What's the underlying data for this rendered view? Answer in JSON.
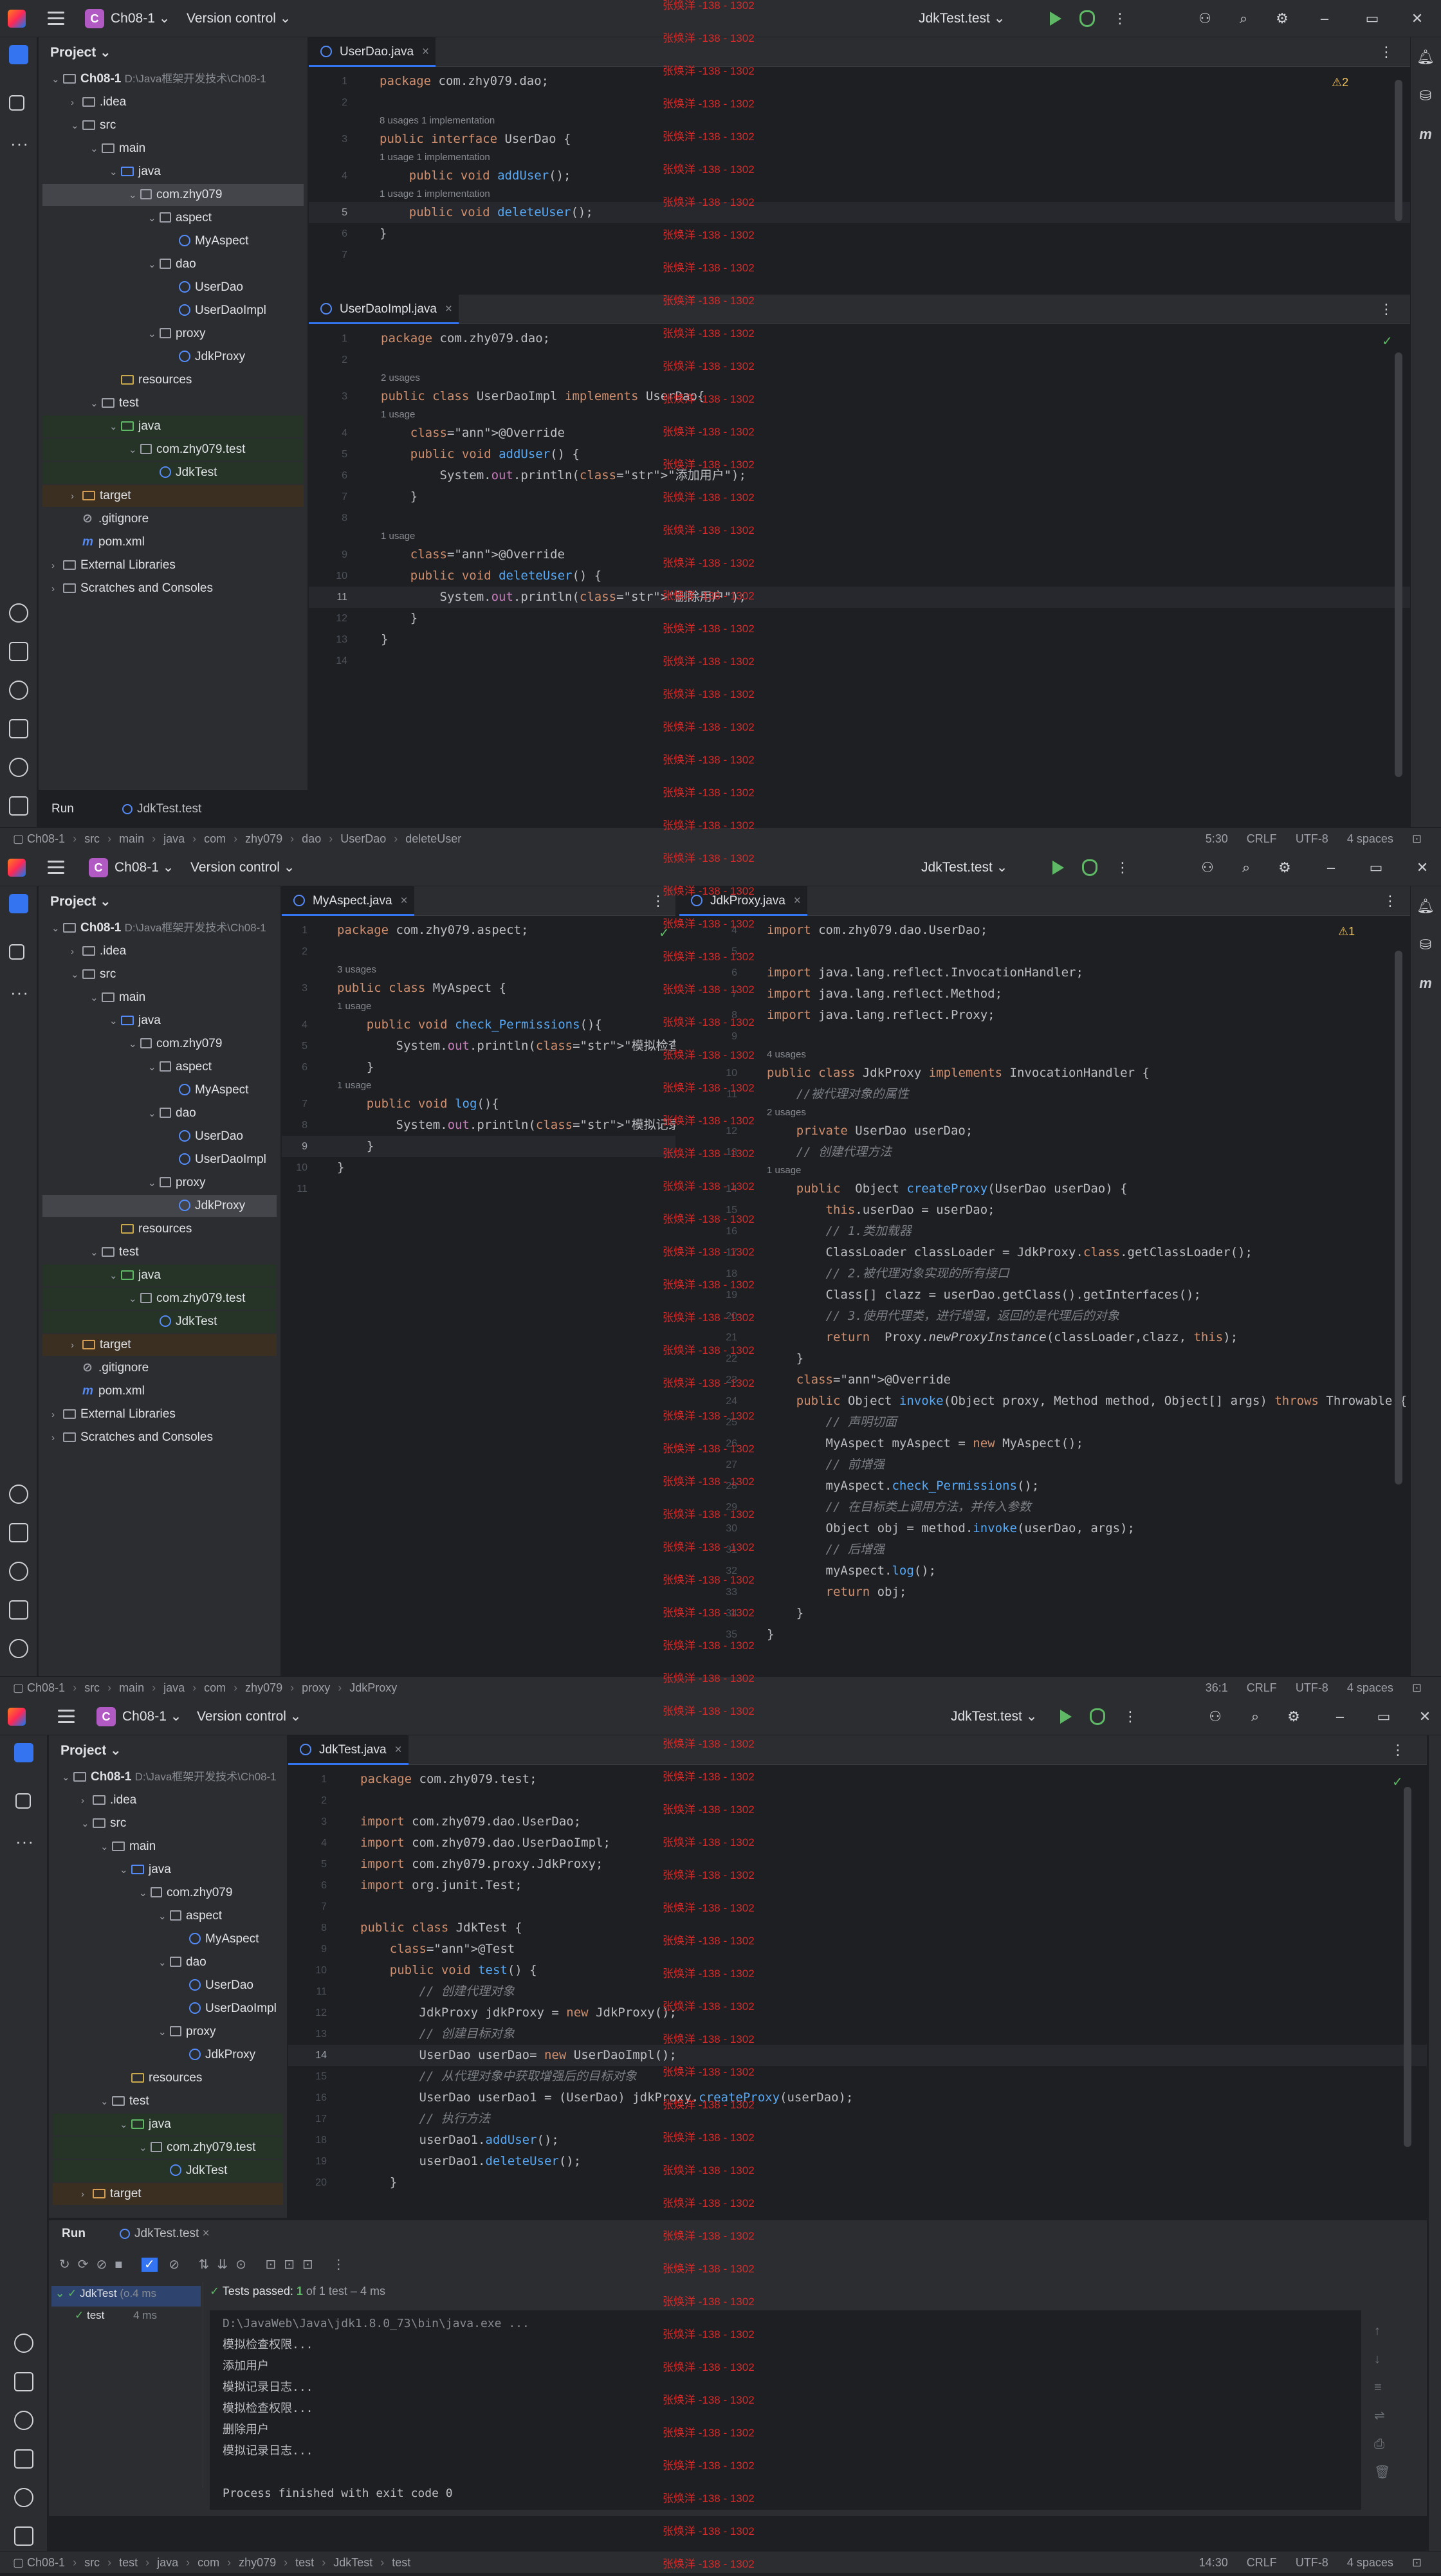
{
  "watermark": "张焕洋 -138 - 1302",
  "project": {
    "badge": "C",
    "name": "Ch08-1",
    "vcs": "Version control",
    "run_config": "JdkTest.test",
    "panel_title": "Project"
  },
  "tree": {
    "root": "Ch08-1",
    "root_path": "D:\\Java框架开发技术\\Ch08-1",
    "idea": ".idea",
    "src": "src",
    "main": "main",
    "java": "java",
    "pkg": "com.zhy079",
    "aspect": "aspect",
    "myaspect": "MyAspect",
    "dao": "dao",
    "userdao": "UserDao",
    "userdaoimpl": "UserDaoImpl",
    "proxy": "proxy",
    "jdkproxy": "JdkProxy",
    "resources": "resources",
    "test": "test",
    "test_java": "java",
    "test_pkg": "com.zhy079.test",
    "jdktest": "JdkTest",
    "target": "target",
    "gitignore": ".gitignore",
    "pom": "pom.xml",
    "ext_libs": "External Libraries",
    "scratches": "Scratches and Consoles"
  },
  "win1": {
    "tab_a": "UserDao.java",
    "tab_b": "UserDaoImpl.java",
    "warn": "⚠2",
    "usages_8": "8 usages",
    "impl_1": "1 implementation",
    "usage_1": "1 usage",
    "usages_2": "2 usages",
    "run_label": "Run",
    "run_tab": "JdkTest.test",
    "status_path": [
      "Ch08-1",
      "src",
      "main",
      "java",
      "com",
      "zhy079",
      "dao",
      "UserDao",
      "deleteUser"
    ],
    "status_pos": "5:30",
    "status_le": "CRLF",
    "status_enc": "UTF-8",
    "status_indent": "4 spaces"
  },
  "win2": {
    "tab_a": "MyAspect.java",
    "tab_b": "JdkProxy.java",
    "warn": "⚠1",
    "usages_3": "3 usages",
    "usage_1": "1 usage",
    "usages_4": "4 usages",
    "usages_2": "2 usages",
    "status_path": [
      "Ch08-1",
      "src",
      "main",
      "java",
      "com",
      "zhy079",
      "proxy",
      "JdkProxy"
    ],
    "status_pos": "36:1",
    "status_le": "CRLF",
    "status_enc": "UTF-8",
    "status_indent": "4 spaces"
  },
  "win3": {
    "tab_a": "JdkTest.java",
    "run_label": "Run",
    "run_tab": "JdkTest.test",
    "tests_passed": "Tests passed:",
    "tests_count": "1",
    "tests_of": "of 1 test – 4 ms",
    "tree_root": "JdkTest",
    "tree_root_time": "(o.4 ms",
    "tree_test": "test",
    "tree_test_time": "4 ms",
    "console": [
      "D:\\JavaWeb\\Java\\jdk1.8.0_73\\bin\\java.exe ...",
      "模拟检查权限...",
      "添加用户",
      "模拟记录日志...",
      "模拟检查权限...",
      "删除用户",
      "模拟记录日志...",
      "",
      "Process finished with exit code 0"
    ],
    "status_path": [
      "Ch08-1",
      "src",
      "test",
      "java",
      "com",
      "zhy079",
      "test",
      "JdkTest",
      "test"
    ],
    "status_pos": "14:30",
    "status_le": "CRLF",
    "status_enc": "UTF-8",
    "status_indent": "4 spaces"
  },
  "code": {
    "userdao": [
      "package com.zhy079.dao;",
      "",
      "public interface UserDao {",
      "    public void addUser();",
      "    public void deleteUser();",
      "}",
      ""
    ],
    "userdaoimpl": [
      "package com.zhy079.dao;",
      "",
      "public class UserDaoImpl implements UserDao{",
      "    @Override",
      "    public void addUser() {",
      "        System.out.println(\"添加用户\");",
      "    }",
      "",
      "    @Override",
      "    public void deleteUser() {",
      "        System.out.println(\"删除用户\");",
      "    }",
      "}",
      ""
    ],
    "myaspect": [
      "package com.zhy079.aspect;",
      "",
      "public class MyAspect {",
      "    public void check_Permissions(){",
      "        System.out.println(\"模拟检查权限...\");",
      "    }",
      "    public void log(){",
      "        System.out.println(\"模拟记录日志...\");",
      "    }",
      "}",
      ""
    ],
    "jdkproxy": [
      "import com.zhy079.dao.UserDao;",
      "",
      "import java.lang.reflect.InvocationHandler;",
      "import java.lang.reflect.Method;",
      "import java.lang.reflect.Proxy;",
      "",
      "public class JdkProxy implements InvocationHandler {",
      "    //被代理对象的属性",
      "    private UserDao userDao;",
      "    // 创建代理方法",
      "    public  Object createProxy(UserDao userDao) {",
      "        this.userDao = userDao;",
      "        // 1.类加载器",
      "        ClassLoader classLoader = JdkProxy.class.getClassLoader();",
      "        // 2.被代理对象实现的所有接口",
      "        Class[] clazz = userDao.getClass().getInterfaces();",
      "        // 3.使用代理类，进行增强，返回的是代理后的对象",
      "        return  Proxy.newProxyInstance(classLoader,clazz, this);",
      "    }",
      "    @Override",
      "    public Object invoke(Object proxy, Method method, Object[] args) throws Throwable {",
      "        // 声明切面",
      "        MyAspect myAspect = new MyAspect();",
      "        // 前增强",
      "        myAspect.check_Permissions();",
      "        // 在目标类上调用方法，并传入参数",
      "        Object obj = method.invoke(userDao, args);",
      "        // 后增强",
      "        myAspect.log();",
      "        return obj;",
      "    }",
      "}"
    ],
    "jdktest": [
      "package com.zhy079.test;",
      "",
      "import com.zhy079.dao.UserDao;",
      "import com.zhy079.dao.UserDaoImpl;",
      "import com.zhy079.proxy.JdkProxy;",
      "import org.junit.Test;",
      "",
      "public class JdkTest {",
      "    @Test",
      "    public void test() {",
      "        // 创建代理对象",
      "        JdkProxy jdkProxy = new JdkProxy();",
      "        // 创建目标对象",
      "        UserDao userDao= new UserDaoImpl();",
      "        // 从代理对象中获取增强后的目标对象",
      "        UserDao userDao1 = (UserDao) jdkProxy.createProxy(userDao);",
      "        // 执行方法",
      "        userDao1.addUser();",
      "        userDao1.deleteUser();",
      "    }"
    ]
  },
  "line_numbers": {
    "userdao": [
      "1",
      "2",
      "3",
      "4",
      "5",
      "6",
      "7"
    ],
    "userdaoimpl": [
      "1",
      "2",
      "3",
      "4",
      "5",
      "6",
      "7",
      "8",
      "9",
      "10",
      "11",
      "12",
      "13",
      "14"
    ],
    "myaspect": [
      "1",
      "2",
      "3",
      "4",
      "5",
      "6",
      "7",
      "8",
      "9",
      "10",
      "11"
    ],
    "jdkproxy": [
      "4",
      "5",
      "6",
      "7",
      "8",
      "9",
      "10",
      "11",
      "12",
      "13",
      "14",
      "15",
      "16",
      "17",
      "18",
      "19",
      "20",
      "21",
      "22",
      "23",
      "24",
      "25",
      "26",
      "27",
      "28",
      "29",
      "30",
      "31",
      "32",
      "33",
      "34",
      "35"
    ],
    "jdktest": [
      "1",
      "2",
      "3",
      "4",
      "5",
      "6",
      "7",
      "8",
      "9",
      "10",
      "11",
      "12",
      "13",
      "14",
      "15",
      "16",
      "17",
      "18",
      "19",
      "20"
    ]
  }
}
